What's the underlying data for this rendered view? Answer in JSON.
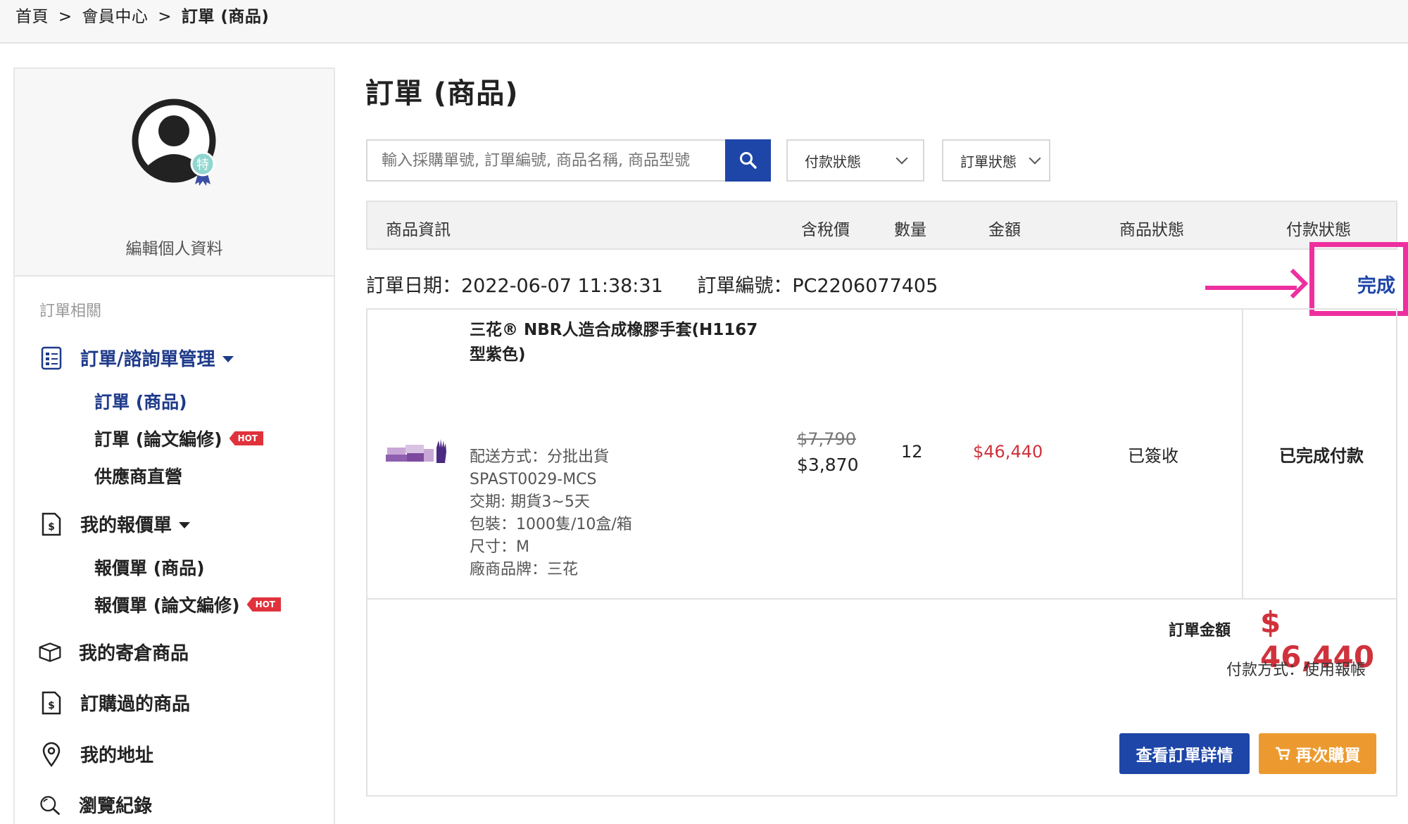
{
  "breadcrumb": {
    "home": "首頁",
    "sep1": ">",
    "member": "會員中心",
    "sep2": ">",
    "current": "訂單 (商品)"
  },
  "sidebar": {
    "edit_profile": "編輯個人資料",
    "badge_char": "特",
    "section_label": "訂單相關",
    "order_mgmt": "訂單/諮詢單管理",
    "order_products": "訂單 (商品)",
    "order_editing": "訂單 (論文編修)",
    "supplier_direct": "供應商直營",
    "my_quotes": "我的報價單",
    "quote_products": "報價單 (商品)",
    "quote_editing": "報價單 (論文編修)",
    "hot": "HOT",
    "warehouse": "我的寄倉商品",
    "purchased": "訂購過的商品",
    "address": "我的地址",
    "history": "瀏覽紀錄"
  },
  "main": {
    "title": "訂單 (商品)",
    "search_placeholder": "輸入採購單號, 訂單編號, 商品名稱, 商品型號",
    "payment_filter": "付款狀態",
    "order_filter": "訂單狀態"
  },
  "table": {
    "headers": {
      "info": "商品資訊",
      "price": "含稅價",
      "qty": "數量",
      "amount": "金額",
      "item_status": "商品狀態",
      "pay_status": "付款狀態"
    }
  },
  "order": {
    "date": "訂單日期：2022-06-07 11:38:31",
    "number": "訂單編號：PC2206077405",
    "status": "完成",
    "product_name": "三花® NBR人造合成橡膠手套(H1167型紫色)",
    "details": [
      "配送方式：分批出貨",
      "SPAST0029-MCS",
      "交期: 期貨3~5天",
      "包裝：1000隻/10盒/箱",
      "尺寸：M",
      "廠商品牌：三花"
    ],
    "price_old": "$7,790",
    "price_new": "$3,870",
    "qty": "12",
    "amount": "$46,440",
    "item_status": "已簽收",
    "pay_status": "已完成付款",
    "total_label": "訂單金額",
    "total_value": "$ 46,440",
    "pay_method": "付款方式：使用報帳",
    "btn_detail": "查看訂單詳情",
    "btn_rebuy": "再次購買"
  },
  "colors": {
    "brand_blue": "#1e46a8",
    "price_red": "#d0323c",
    "rebuy_orange": "#ec9a30",
    "annotation_pink": "#ee2fa0"
  }
}
